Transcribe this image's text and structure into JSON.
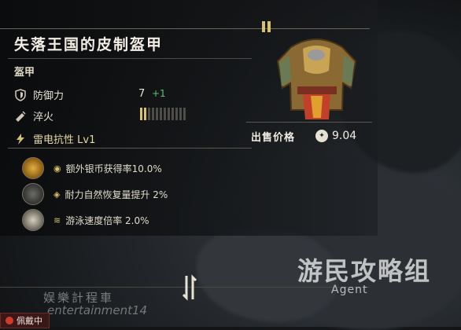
{
  "item": {
    "name": "失落王国的皮制盔甲",
    "category": "盔甲",
    "stats": {
      "defense_label": "防御力",
      "defense_value": "7",
      "defense_bonus": "+1",
      "temper_label": "淬火",
      "temper_level": 2,
      "temper_max": 12,
      "element_label": "雷电抗性 Lv1"
    },
    "sell": {
      "label": "出售价格",
      "value": "9.04"
    }
  },
  "perks": [
    {
      "text": "额外银币获得率10.0%"
    },
    {
      "text": "耐力自然恢复量提升 2%"
    },
    {
      "text": "游泳速度倍率 2.0%"
    }
  ],
  "footer": {
    "equipped_label": "佩戴中"
  },
  "watermarks": {
    "line1": "娱樂計程車",
    "line2": "entertainment14",
    "logo": "游民攻略组",
    "logo_sub": "Agent"
  },
  "colors": {
    "accent_gold": "#d8c071",
    "bonus_green": "#59c47a",
    "badge_red": "#d23a2a"
  },
  "icons": [
    "shield-icon",
    "temper-icon",
    "lightning-icon",
    "pause-icon",
    "coin-icon",
    "swap-icon"
  ]
}
